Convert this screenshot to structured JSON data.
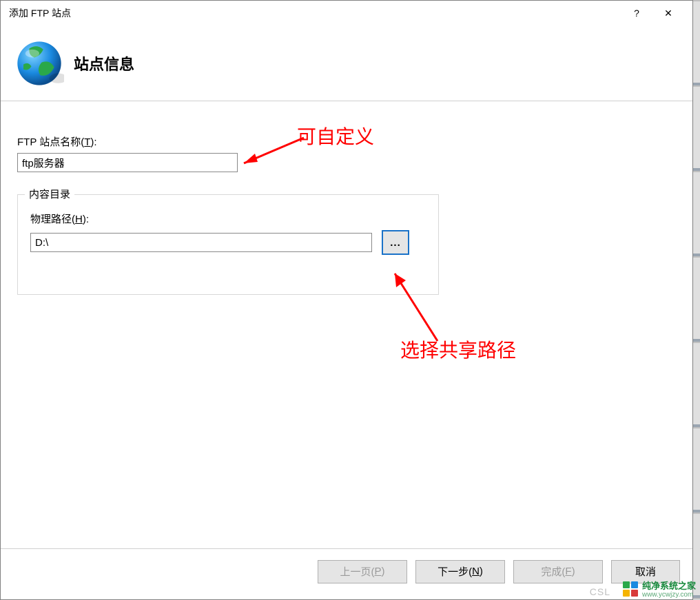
{
  "titlebar": {
    "title": "添加 FTP 站点",
    "help": "?",
    "close": "✕"
  },
  "header": {
    "heading": "站点信息"
  },
  "form": {
    "site_name_label_pre": "FTP 站点名称(",
    "site_name_hotkey": "T",
    "site_name_label_post": "):",
    "site_name_value": "ftp服务器",
    "content_dir_legend": "内容目录",
    "physical_path_label_pre": "物理路径(",
    "physical_path_hotkey": "H",
    "physical_path_label_post": "):",
    "physical_path_value": "D:\\",
    "browse_label": "..."
  },
  "annotations": {
    "custom": "可自定义",
    "share_path": "选择共享路径"
  },
  "footer": {
    "prev_pre": "上一页(",
    "prev_hk": "P",
    "prev_post": ")",
    "next_pre": "下一步(",
    "next_hk": "N",
    "next_post": ")",
    "finish_pre": "完成(",
    "finish_hk": "F",
    "finish_post": ")",
    "cancel": "取消"
  },
  "watermark": {
    "csl": "CSL",
    "brand": "纯净系统之家",
    "url": "www.ycwjzy.com"
  }
}
